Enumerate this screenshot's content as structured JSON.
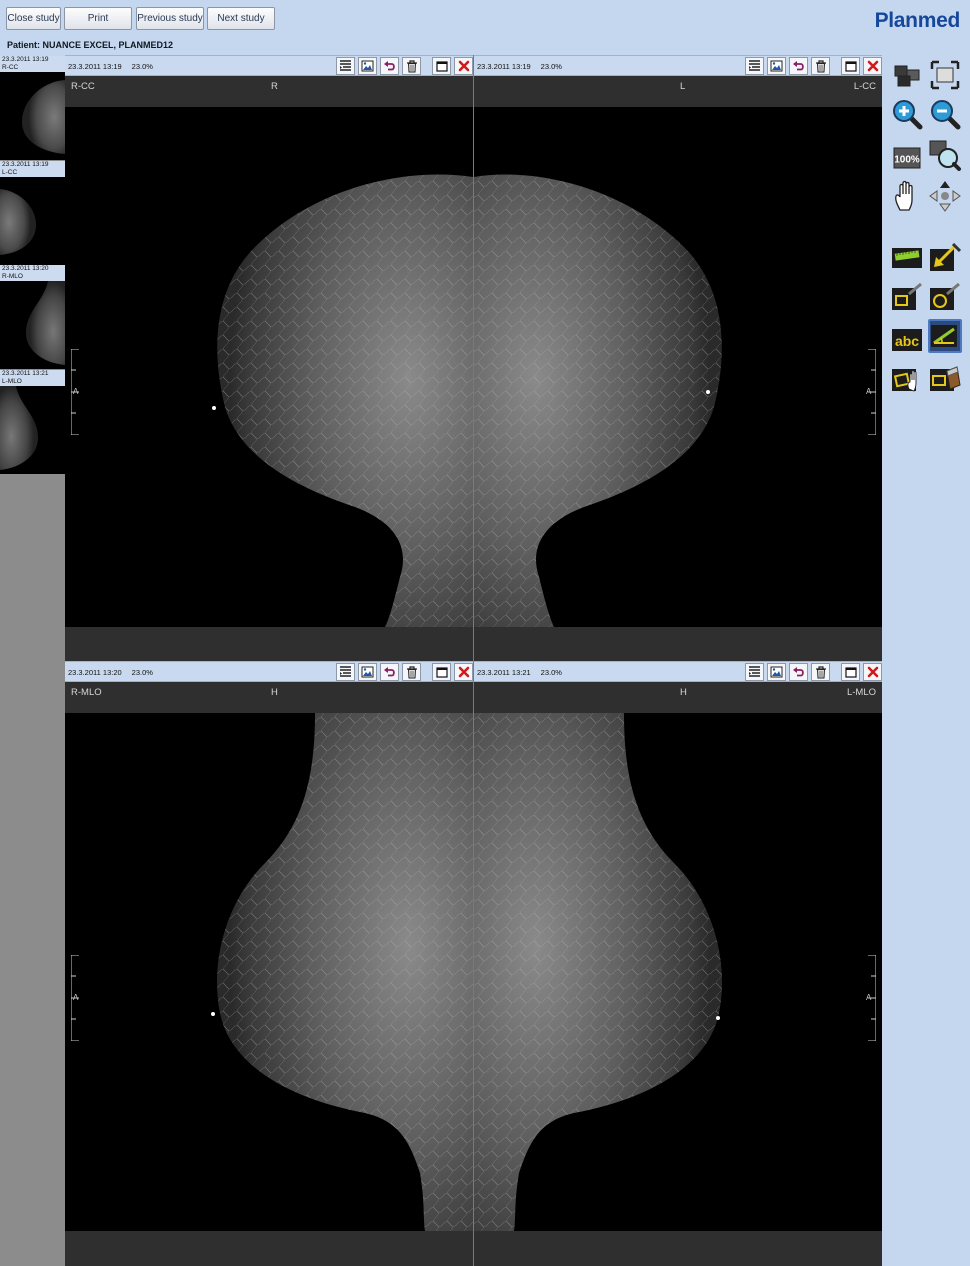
{
  "toolbar": {
    "close_label": "Close study",
    "print_label": "Print",
    "previous_label": "Previous study",
    "next_label": "Next study"
  },
  "brand": {
    "logo": "Planmed",
    "color": "#16489a"
  },
  "patient": {
    "label": "Patient: NUANCE EXCEL, PLANMED12"
  },
  "thumbnails": [
    {
      "date": "23.3.2011 13:19",
      "view": "R-CC"
    },
    {
      "date": "23.3.2011 13:19",
      "view": "L-CC"
    },
    {
      "date": "23.3.2011 13:20",
      "view": "R-MLO"
    },
    {
      "date": "23.3.2011 13:21",
      "view": "L-MLO"
    }
  ],
  "panes": [
    {
      "date": "23.3.2011 13:19",
      "zoom": "23.0%",
      "view": "R-CC",
      "orient": "R",
      "marker": "A"
    },
    {
      "date": "23.3.2011 13:19",
      "zoom": "23.0%",
      "view": "L-CC",
      "orient": "L",
      "marker": "A"
    },
    {
      "date": "23.3.2011 13:20",
      "zoom": "23.0%",
      "view": "R-MLO",
      "orient": "H",
      "marker": "A"
    },
    {
      "date": "23.3.2011 13:21",
      "zoom": "23.0%",
      "view": "L-MLO",
      "orient": "H",
      "marker": "A"
    }
  ],
  "pane_tools": [
    "list-icon",
    "image-settings-icon",
    "undo-icon",
    "trash-icon",
    "maximize-icon",
    "close-icon"
  ],
  "side_tools": {
    "zoom_100_label": "100%",
    "text_tool_label": "abc",
    "icons": [
      "layout-icon",
      "fit-screen-icon",
      "zoom-in-icon",
      "zoom-out-icon",
      "zoom-100-icon",
      "magnifier-icon",
      "pan-hand-icon",
      "move-arrows-icon",
      "ruler-icon",
      "arrow-annotation-icon",
      "rectangle-roi-icon",
      "ellipse-roi-icon",
      "text-annotation-icon",
      "angle-measure-icon",
      "select-annotation-icon",
      "delete-annotation-icon"
    ]
  },
  "colors": {
    "panel_bg": "#c5d6ef",
    "header_bg": "#c8d9f0",
    "close_red": "#d11a1a",
    "accent_blue": "#16489a"
  }
}
